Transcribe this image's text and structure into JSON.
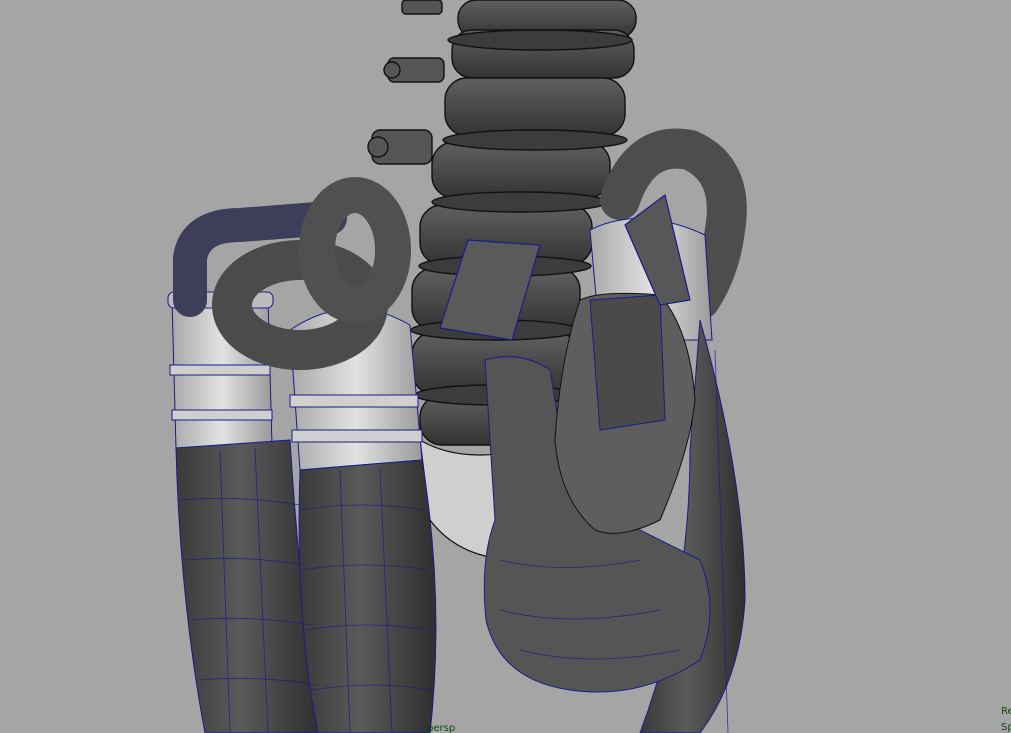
{
  "viewport": {
    "camera_label": "persp",
    "hud_stats": [
      "Re",
      "Sp"
    ]
  },
  "colors": {
    "background": "#a5a5a5",
    "mesh_dark": "#4b4b4b",
    "mesh_mid": "#5c5c5c",
    "mesh_light": "#d7d7d7",
    "wireframe": "#1a1a8c",
    "hud_text": "#0b4a0b"
  }
}
